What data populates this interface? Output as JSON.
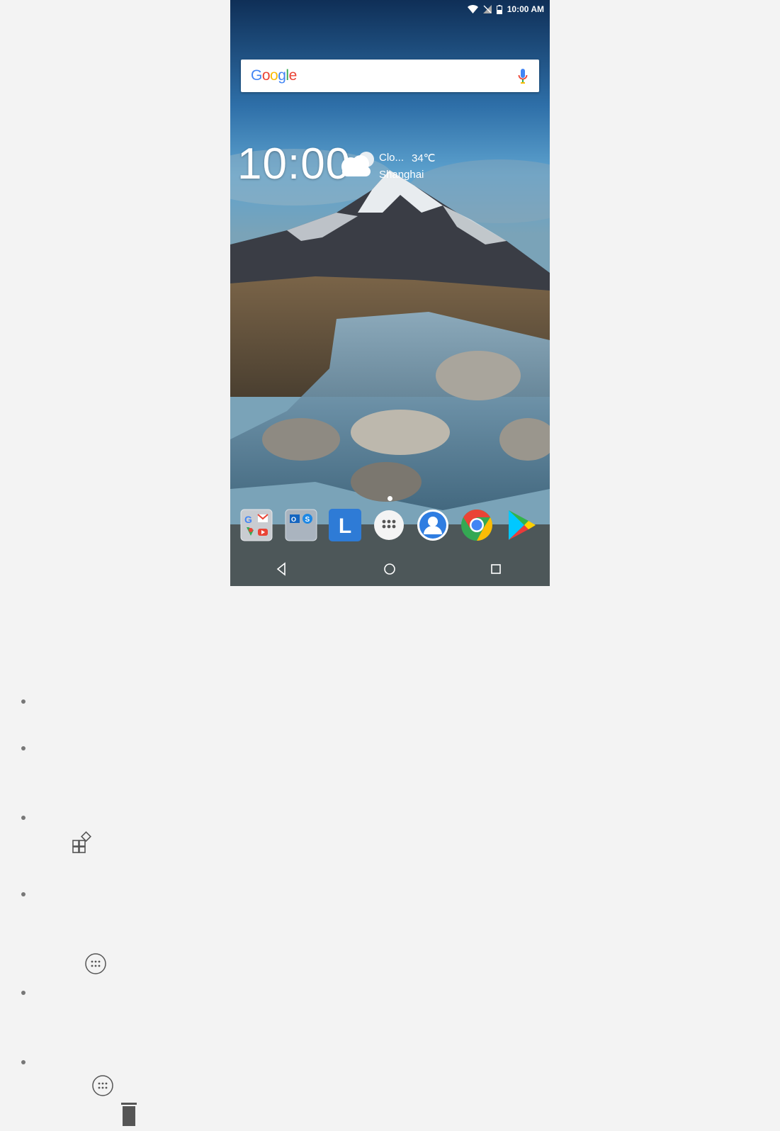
{
  "status": {
    "time": "10:00 AM"
  },
  "search": {
    "logo": "Google",
    "mic_icon": "mic-icon"
  },
  "clock": {
    "time": "10:00"
  },
  "weather": {
    "condition": "Clo...",
    "temperature": "34℃",
    "city": "Shanghai",
    "icon": "cloud-icon"
  },
  "dock": {
    "apps": [
      {
        "name": "google-folder",
        "icon": "google-apps-folder-icon"
      },
      {
        "name": "office-folder",
        "icon": "office-apps-folder-icon"
      },
      {
        "name": "lenovo-app",
        "icon": "letter-l-icon",
        "glyph": "L"
      },
      {
        "name": "app-drawer",
        "icon": "all-apps-icon"
      },
      {
        "name": "contacts",
        "icon": "contact-icon"
      },
      {
        "name": "chrome",
        "icon": "chrome-icon"
      },
      {
        "name": "play-store",
        "icon": "play-store-icon"
      }
    ]
  },
  "nav": {
    "back": "back-icon",
    "home": "home-icon",
    "recents": "recents-icon"
  },
  "colors": {
    "accent_blue": "#4285F4",
    "red": "#EA4335",
    "yellow": "#FBBC05",
    "green": "#34A853",
    "lenovo_blue": "#2e7bd6"
  }
}
